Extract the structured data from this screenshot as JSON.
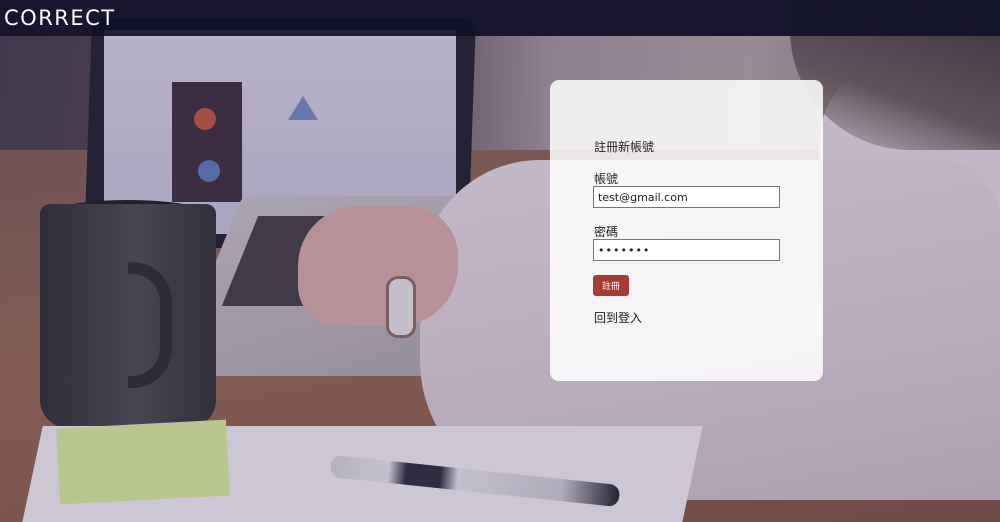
{
  "navbar": {
    "brand": "CORRECT"
  },
  "register_form": {
    "title": "註冊新帳號",
    "account_label": "帳號",
    "account_value": "test@gmail.com",
    "password_label": "密碼",
    "password_value": "•••••••",
    "submit_label": "註冊",
    "login_link": "回到登入"
  },
  "colors": {
    "navbar_bg": "#0e1028",
    "button_bg": "#a63a35",
    "card_bg": "#ffffff"
  }
}
